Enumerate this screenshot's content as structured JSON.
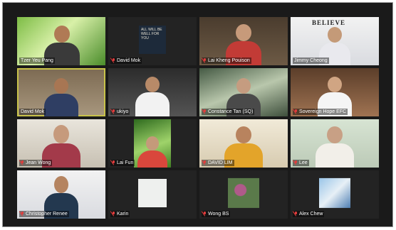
{
  "participants": [
    {
      "name": "Tzer Yeu Pang",
      "muted": false
    },
    {
      "name": "David Mok",
      "muted": true
    },
    {
      "name": "Lai Kheng Pouison",
      "muted": true
    },
    {
      "name": "Jimmy Cheong",
      "muted": false
    },
    {
      "name": "David Mok",
      "muted": false,
      "active_speaker": true
    },
    {
      "name": "ukiyo",
      "muted": true
    },
    {
      "name": "Constance Tan (SQ)",
      "muted": true
    },
    {
      "name": "Sovereign Hope EFC",
      "muted": true
    },
    {
      "name": "Jean Wong",
      "muted": true
    },
    {
      "name": "Lai Fun",
      "muted": true
    },
    {
      "name": "DAVID LIM",
      "muted": true
    },
    {
      "name": "Lee",
      "muted": true
    },
    {
      "name": "Christopher Renee",
      "muted": true
    },
    {
      "name": "Karin",
      "muted": true
    },
    {
      "name": "Wong BS",
      "muted": true
    },
    {
      "name": "Alex Chew",
      "muted": true
    }
  ],
  "book_cover_text": "ALL WILL BE WELL FOR YOU",
  "background_text": "BELIEVE",
  "colors": {
    "active_border": "#c8c24a",
    "mute": "#e23c3c"
  }
}
